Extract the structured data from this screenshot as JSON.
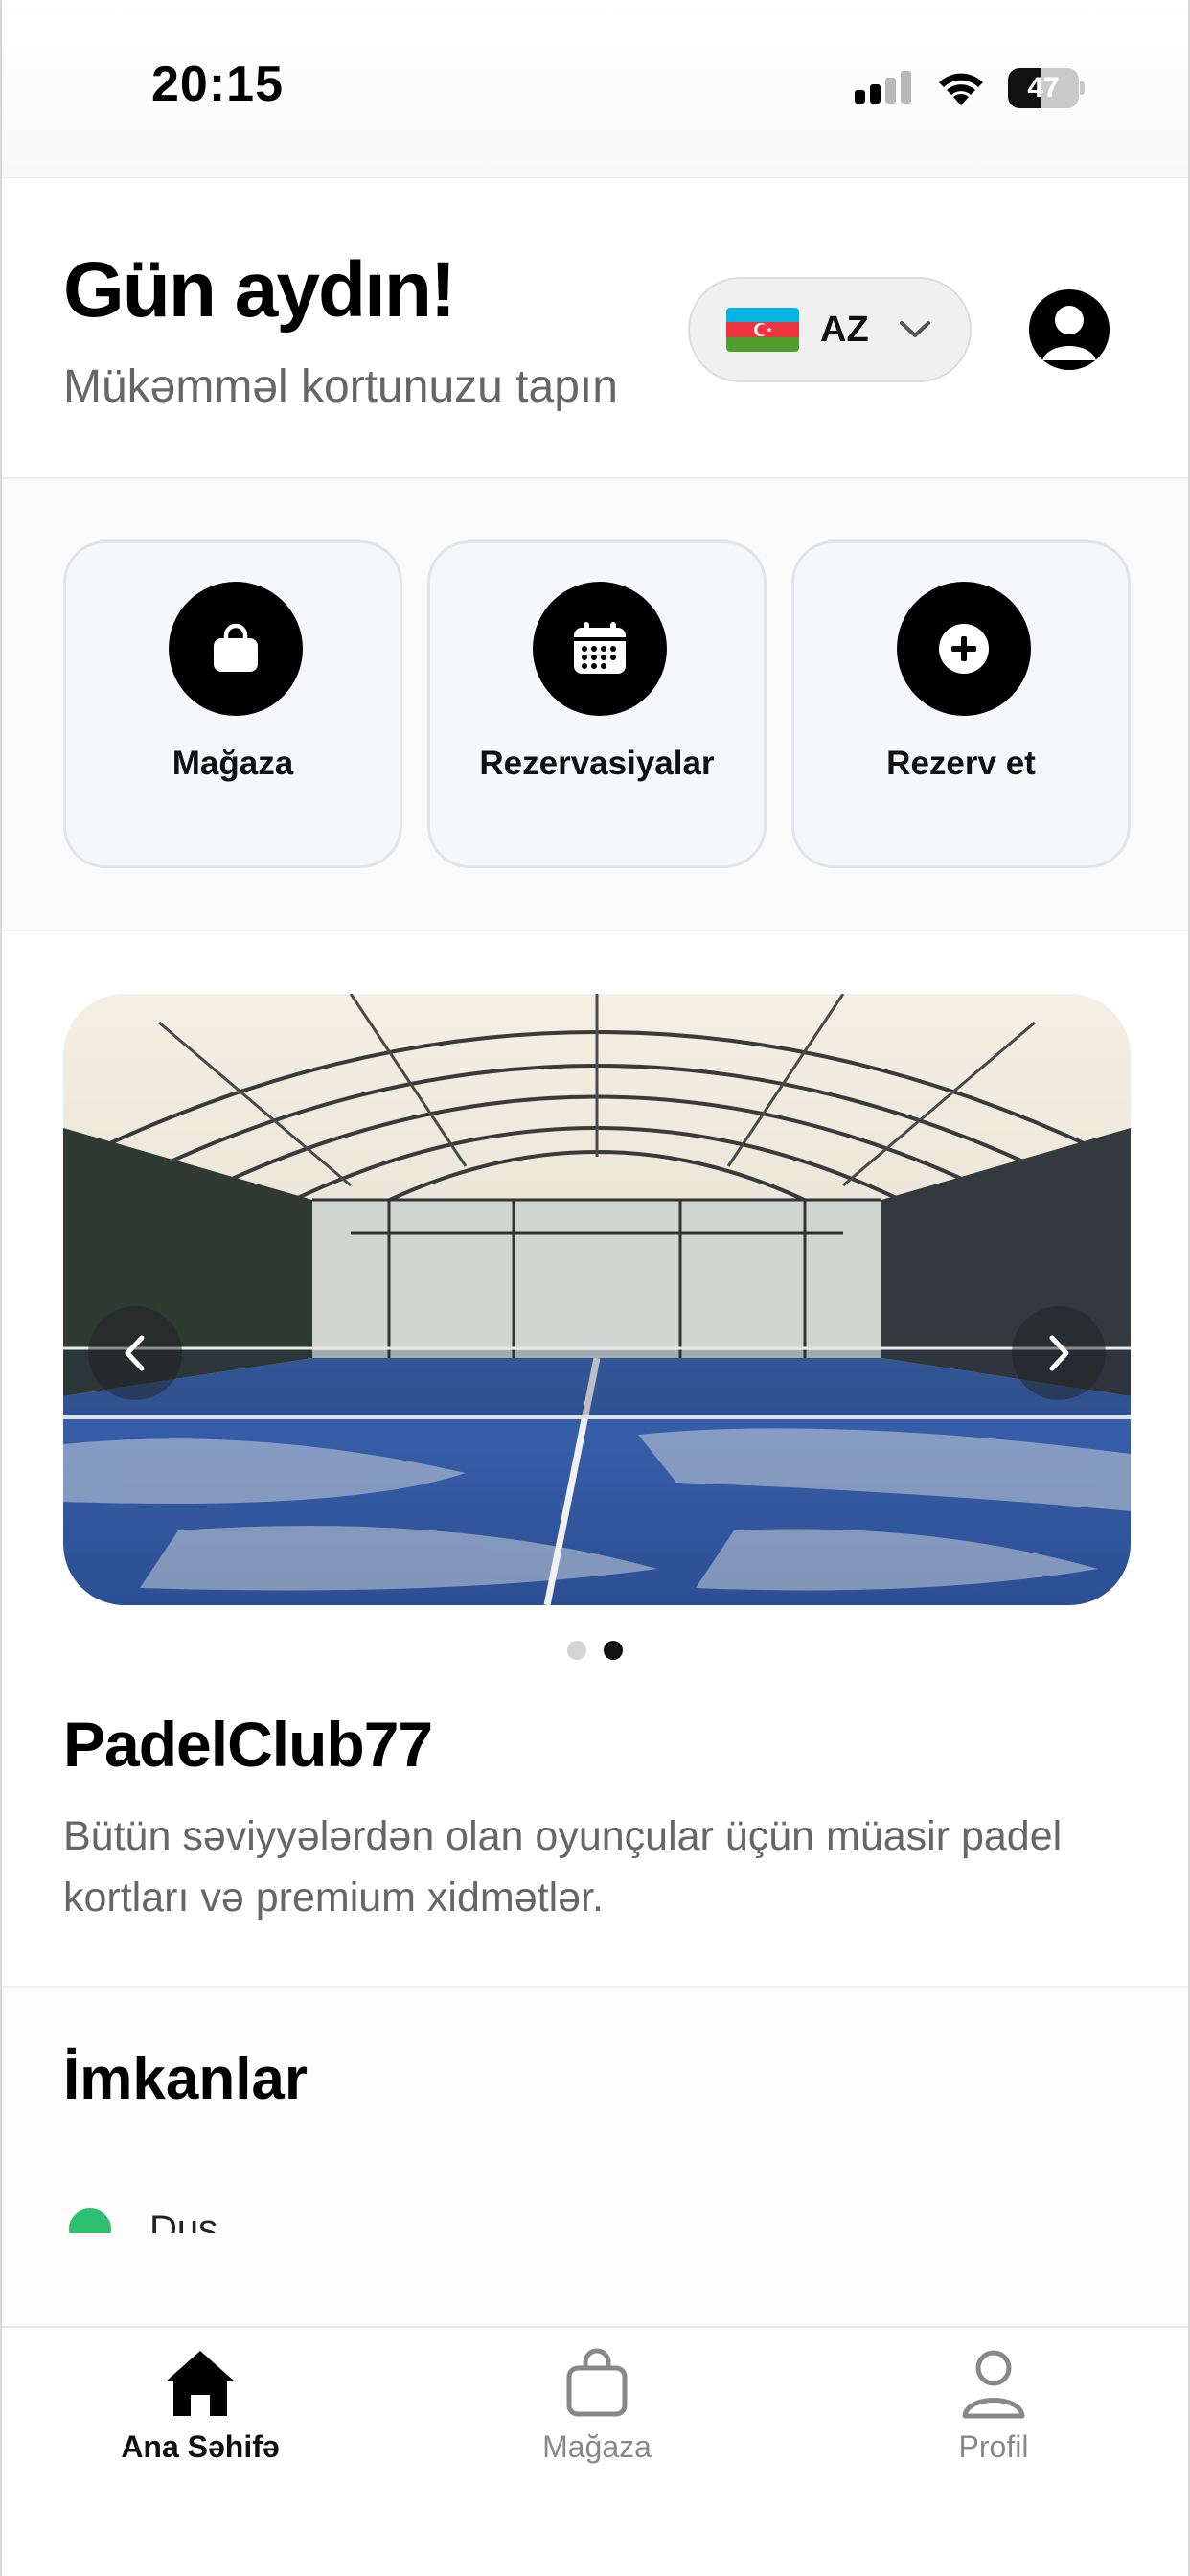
{
  "status_bar": {
    "time": "20:15",
    "battery": "47",
    "battery_level": 0.47
  },
  "header": {
    "greeting": "Gün aydın!",
    "subtitle": "Mükəmməl kortunuzu tapın",
    "language_code": "AZ"
  },
  "quick_actions": [
    {
      "label": "Mağaza",
      "icon": "shopping-bag-icon"
    },
    {
      "label": "Rezervasiyalar",
      "icon": "calendar-icon"
    },
    {
      "label": "Rezerv et",
      "icon": "plus-circle-icon"
    }
  ],
  "club": {
    "carousel": {
      "slide_count": 2,
      "active_index": 1
    },
    "name": "PadelClub77",
    "description": "Bütün səviyyələrdən olan oyunçular üçün müasir padel kortları və premium xidmətlər."
  },
  "features": {
    "title": "İmkanlar",
    "first_item_partial": "Duş"
  },
  "tab_bar": {
    "items": [
      {
        "label": "Ana Səhifə",
        "icon": "home-icon",
        "active": true
      },
      {
        "label": "Mağaza",
        "icon": "shopping-bag-icon",
        "active": false
      },
      {
        "label": "Profil",
        "icon": "user-icon",
        "active": false
      }
    ]
  },
  "colors": {
    "accent": "#000000",
    "feature_check": "#2fbf71",
    "court": "#2e5aa8"
  }
}
